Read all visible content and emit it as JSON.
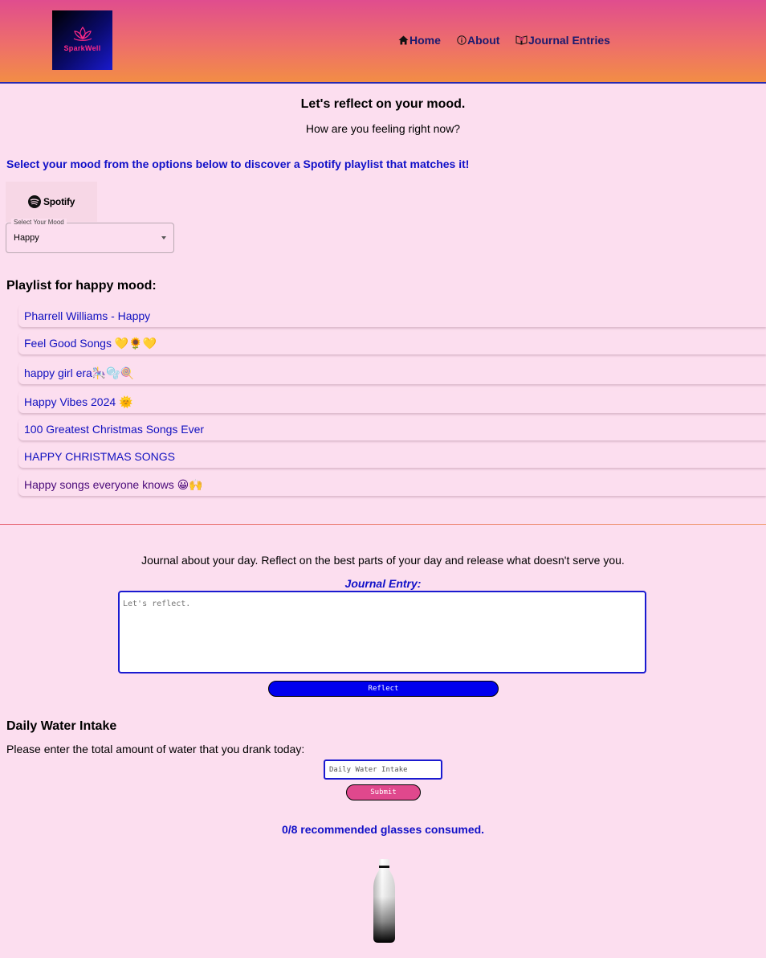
{
  "header": {
    "logo_text": "SparkWell",
    "nav": {
      "home": "Home",
      "about": "About",
      "journal": "Journal Entries"
    }
  },
  "mood": {
    "title": "Let's reflect on your mood.",
    "subtitle": "How are you feeling right now?",
    "instruction": "Select your mood from the options below to discover a Spotify playlist that matches it!",
    "spotify_label": "Spotify",
    "select_label": "Select Your Mood",
    "select_value": "Happy"
  },
  "playlists": {
    "heading": "Playlist for happy mood:",
    "items": [
      "Pharrell Williams - Happy",
      "Feel Good Songs 💛🌻💛",
      "happy girl era🎠🫧🍭",
      "Happy Vibes 2024 🌞",
      "100 Greatest Christmas Songs Ever",
      "HAPPY CHRISTMAS SONGS",
      "Happy songs everyone knows 😀🙌"
    ]
  },
  "journal": {
    "prompt": "Journal about your day. Reflect on the best parts of your day and release what doesn't serve you.",
    "label": "Journal Entry:",
    "placeholder": "Let's reflect.",
    "button": "Reflect"
  },
  "water": {
    "heading": "Daily Water Intake",
    "text": "Please enter the total amount of water that you drank today:",
    "placeholder": "Daily Water Intake",
    "button": "Submit",
    "status": "0/8 recommended glasses consumed.",
    "glasses_consumed": 0,
    "glasses_recommended": 8
  },
  "colors": {
    "background": "#fcdeef",
    "link": "#1010c0",
    "accent_blue": "#0000ee",
    "accent_pink": "#e0488d"
  }
}
